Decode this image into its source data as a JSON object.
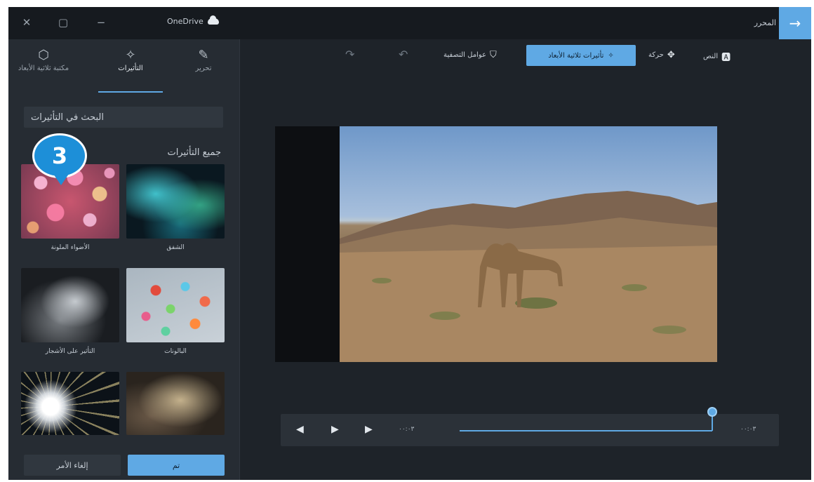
{
  "titlebar": {
    "app_name": "OneDrive",
    "title": "المحرر",
    "back_icon": "arrow-right-icon",
    "controls": [
      "close-icon",
      "maximize-icon",
      "minimize-icon"
    ]
  },
  "panel": {
    "tabs": [
      {
        "label": "مكتبة ثلاثية الأبعاد",
        "icon": "cube-icon"
      },
      {
        "label": "التأثيرات",
        "icon": "effects-icon",
        "active": true
      },
      {
        "label": "تحرير",
        "icon": "pencil-icon"
      }
    ],
    "search_placeholder": "البحث في التأثيرات",
    "section_title": "جميع التأثيرات",
    "callout_number": "3",
    "effects": [
      {
        "label": "الأضواء الملونة",
        "style": "bokeh"
      },
      {
        "label": "الشفق",
        "style": "aurora"
      },
      {
        "label": "التأثير على الأشجار",
        "style": "smoke"
      },
      {
        "label": "البالونات",
        "style": "balloons"
      },
      {
        "label": "",
        "style": "burst"
      },
      {
        "label": "",
        "style": "blur"
      }
    ],
    "cancel_label": "إلغاء الأمر",
    "done_label": "تم"
  },
  "toolbar": {
    "items": [
      {
        "label": "النص",
        "icon": "text-icon"
      },
      {
        "label": "حركة",
        "icon": "motion-icon"
      },
      {
        "label": "تأثيرات ثلاثية الأبعاد",
        "icon": "3d-effects-icon",
        "active": true
      },
      {
        "label": "عوامل التصفية",
        "icon": "filter-icon"
      }
    ],
    "undo_icon": "undo-icon",
    "redo_icon": "redo-icon"
  },
  "timeline": {
    "current_time": "٠٠:٠٣",
    "end_time": "٠٠:٠٣"
  }
}
